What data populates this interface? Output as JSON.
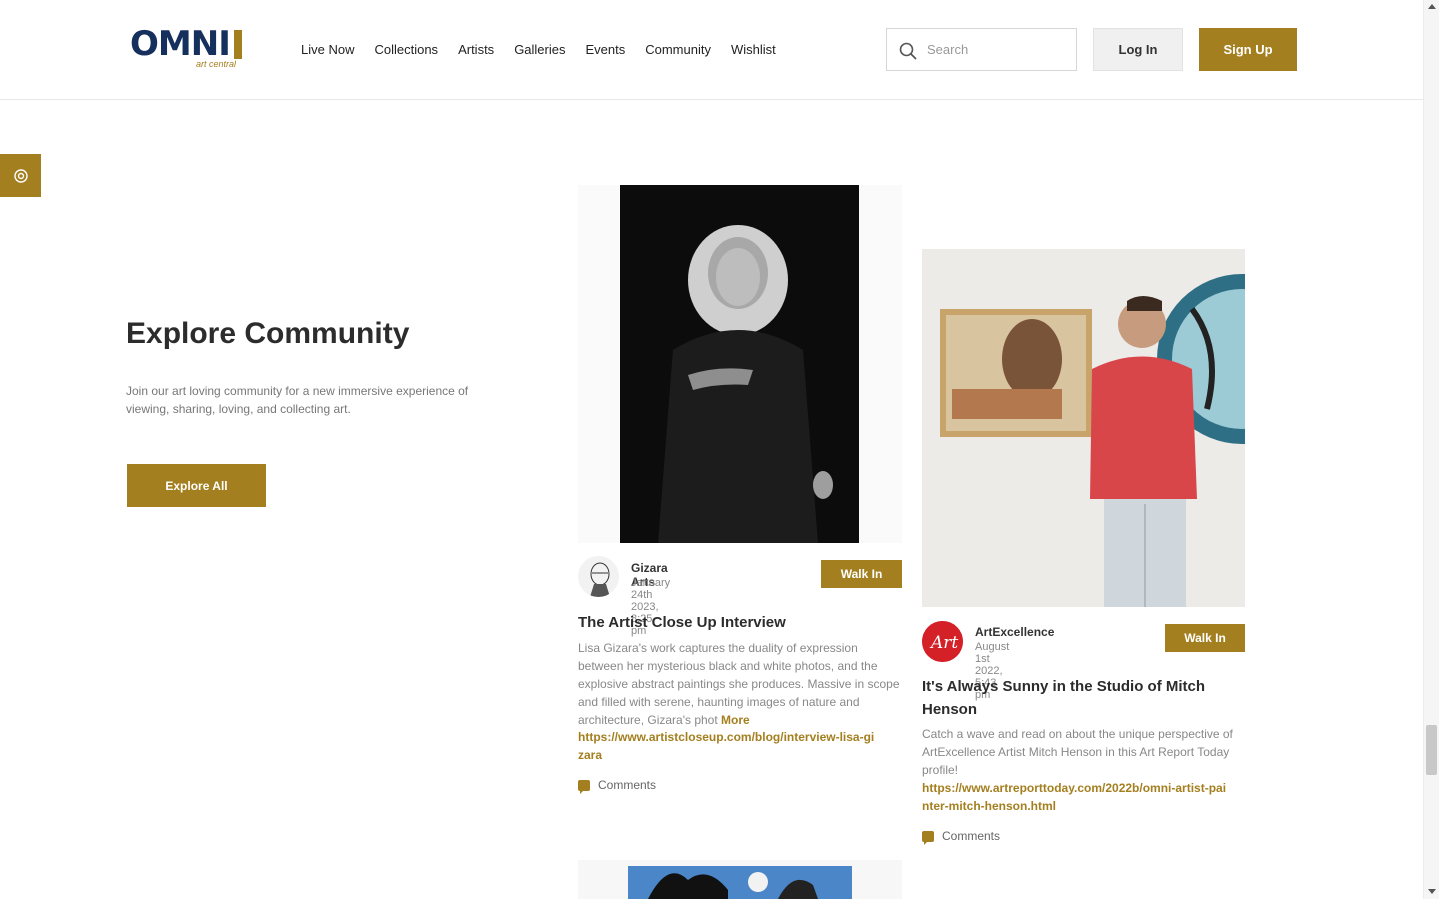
{
  "brand": {
    "name": "OMNI",
    "sub": "art central",
    "accent": "#a47f1f",
    "navy": "#16305e"
  },
  "nav": [
    "Live Now",
    "Collections",
    "Artists",
    "Galleries",
    "Events",
    "Community",
    "Wishlist"
  ],
  "search": {
    "placeholder": "Search",
    "icon": "search-icon"
  },
  "auth": {
    "login": "Log In",
    "signup": "Sign Up"
  },
  "side_button": {
    "icon": "settings-icon"
  },
  "intro": {
    "title": "Explore Community",
    "description": "Join our art loving community for a new immersive experience of viewing, sharing, loving, and collecting art.",
    "button": "Explore All"
  },
  "posts": [
    {
      "author": "Gizara Arts",
      "date": "January 24th 2023, 8:25 pm",
      "walk_in": "Walk In",
      "title": "The Artist Close Up Interview",
      "body": "Lisa Gizara's work captures the duality of expression between her mysterious black and white photos, and the explosive abstract paintings she produces. Massive in scope and filled with serene, haunting images of nature and architecture, Gizara's phot",
      "more": "More",
      "link": "https://www.artistcloseup.com/blog/interview-lisa-gizara",
      "comments": "Comments"
    },
    {
      "author": "ArtExcellence",
      "date": "August 1st 2022, 5:43 pm",
      "walk_in": "Walk In",
      "title": "It's Always Sunny in the Studio of Mitch Henson",
      "body": "Catch a wave and read on about the unique perspective of ArtExcellence Artist Mitch Henson in this Art Report Today profile!",
      "link": "https://www.artreporttoday.com/2022b/omni-artist-painter-mitch-henson.html",
      "comments": "Comments"
    }
  ]
}
